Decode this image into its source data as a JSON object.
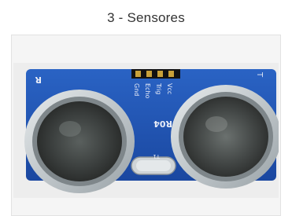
{
  "section": {
    "title": "3 - Sensores"
  },
  "image": {
    "subject": "ultrasonic-sensor-photo",
    "board_label": "HC-SR04",
    "pin_labels": [
      "Vcc",
      "Trig",
      "Echo",
      "Gnd"
    ],
    "side_label_left": "R",
    "side_label_right": "T",
    "crystal_label": "T1"
  },
  "colors": {
    "board_blue": "#1c4fa8",
    "board_dark_blue": "#163c82",
    "transducer_metal": "#c9cfd3",
    "mesh_dark": "#3a3d3c"
  }
}
